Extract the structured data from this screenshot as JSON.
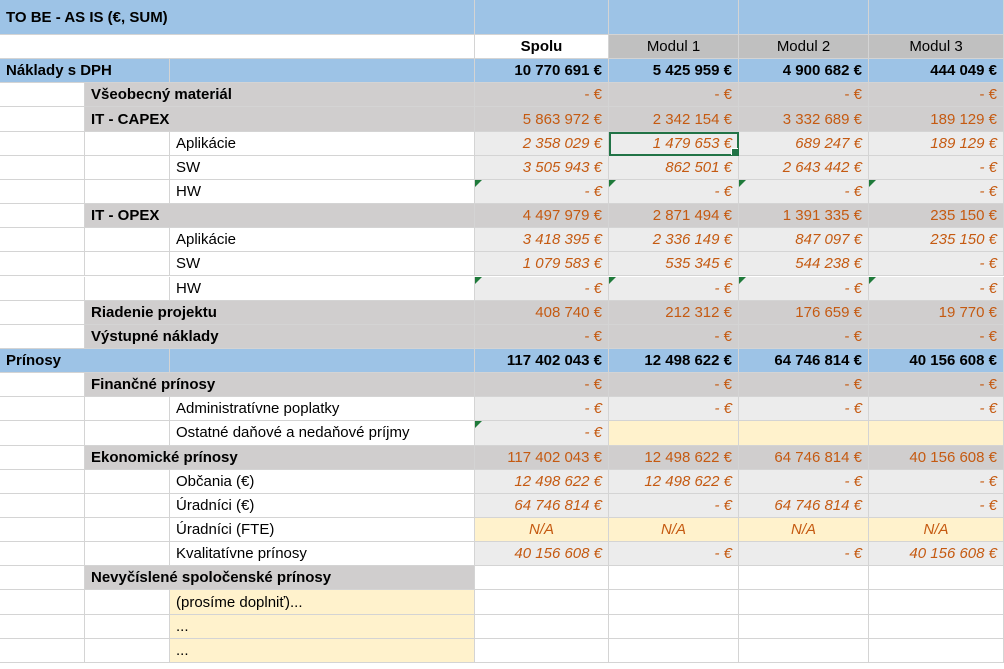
{
  "title": "TO BE - AS IS (€, SUM)",
  "columns": [
    "Spolu",
    "Modul 1",
    "Modul 2",
    "Modul 3"
  ],
  "colors": {
    "band_blue": "#9dc3e6",
    "group_gray": "#d0cece",
    "header_gray": "#c0c0c0",
    "value_gray": "#ececec",
    "input_yellow": "#fff2cc",
    "value_orange": "#c55a11"
  },
  "rows": [
    {
      "type": "section",
      "label": "Náklady s DPH",
      "values": [
        "10 770 691 €",
        "5 425 959 €",
        "4 900 682 €",
        "444 049 €"
      ]
    },
    {
      "type": "group",
      "label": "Všeobecný materiál",
      "values": [
        "- €",
        "- €",
        "- €",
        "- €"
      ]
    },
    {
      "type": "group",
      "label": "IT - CAPEX",
      "values": [
        "5 863 972 €",
        "2 342 154 €",
        "3 332 689 €",
        "189 129 €"
      ]
    },
    {
      "type": "item",
      "label": "Aplikácie",
      "values": [
        "2 358 029 €",
        "1 479 653 €",
        "689 247 €",
        "189 129 €"
      ]
    },
    {
      "type": "item",
      "label": "SW",
      "values": [
        "3 505 943 €",
        "862 501 €",
        "2 643 442 €",
        "- €"
      ]
    },
    {
      "type": "item",
      "label": "HW",
      "values": [
        "- €",
        "- €",
        "- €",
        "- €"
      ]
    },
    {
      "type": "group",
      "label": "IT - OPEX",
      "values": [
        "4 497 979 €",
        "2 871 494 €",
        "1 391 335 €",
        "235 150 €"
      ]
    },
    {
      "type": "item",
      "label": "Aplikácie",
      "values": [
        "3 418 395 €",
        "2 336 149 €",
        "847 097 €",
        "235 150 €"
      ]
    },
    {
      "type": "item",
      "label": "SW",
      "values": [
        "1 079 583 €",
        "535 345 €",
        "544 238 €",
        "- €"
      ]
    },
    {
      "type": "item",
      "label": "HW",
      "values": [
        "- €",
        "- €",
        "- €",
        "- €"
      ]
    },
    {
      "type": "group",
      "label": "Riadenie projektu",
      "values": [
        "408 740 €",
        "212 312 €",
        "176 659 €",
        "19 770 €"
      ]
    },
    {
      "type": "group",
      "label": "Výstupné náklady",
      "values": [
        "- €",
        "- €",
        "- €",
        "- €"
      ]
    },
    {
      "type": "section",
      "label": "Prínosy",
      "values": [
        "117 402 043 €",
        "12 498 622 €",
        "64 746 814 €",
        "40 156 608 €"
      ]
    },
    {
      "type": "group",
      "label": "Finančné prínosy",
      "values": [
        "- €",
        "- €",
        "- €",
        "- €"
      ]
    },
    {
      "type": "item",
      "label": "Administratívne poplatky",
      "values": [
        "- €",
        "- €",
        "- €",
        "- €"
      ]
    },
    {
      "type": "item",
      "label": "Ostatné daňové a nedaňové príjmy",
      "values": [
        "- €",
        "",
        "",
        ""
      ]
    },
    {
      "type": "group",
      "label": "Ekonomické prínosy",
      "values": [
        "117 402 043 €",
        "12 498 622 €",
        "64 746 814 €",
        "40 156 608 €"
      ]
    },
    {
      "type": "item",
      "label": "Občania (€)",
      "values": [
        "12 498 622 €",
        "12 498 622 €",
        "- €",
        "- €"
      ]
    },
    {
      "type": "item",
      "label": "Úradníci (€)",
      "values": [
        "64 746 814 €",
        "- €",
        "64 746 814 €",
        "- €"
      ]
    },
    {
      "type": "item",
      "label": "Úradníci (FTE)",
      "values": [
        "N/A",
        "N/A",
        "N/A",
        "N/A"
      ]
    },
    {
      "type": "item",
      "label": "Kvalitatívne prínosy",
      "values": [
        "40 156 608 €",
        "- €",
        "- €",
        "40 156 608 €"
      ]
    },
    {
      "type": "group",
      "label": "Nevyčíslené spoločenské prínosy",
      "values": [
        "",
        "",
        "",
        ""
      ]
    },
    {
      "type": "input",
      "label": "(prosíme doplniť)...",
      "values": [
        "",
        "",
        "",
        ""
      ]
    },
    {
      "type": "input",
      "label": "...",
      "values": [
        "",
        "",
        "",
        ""
      ]
    },
    {
      "type": "input",
      "label": "...",
      "values": [
        "",
        "",
        "",
        ""
      ]
    }
  ]
}
